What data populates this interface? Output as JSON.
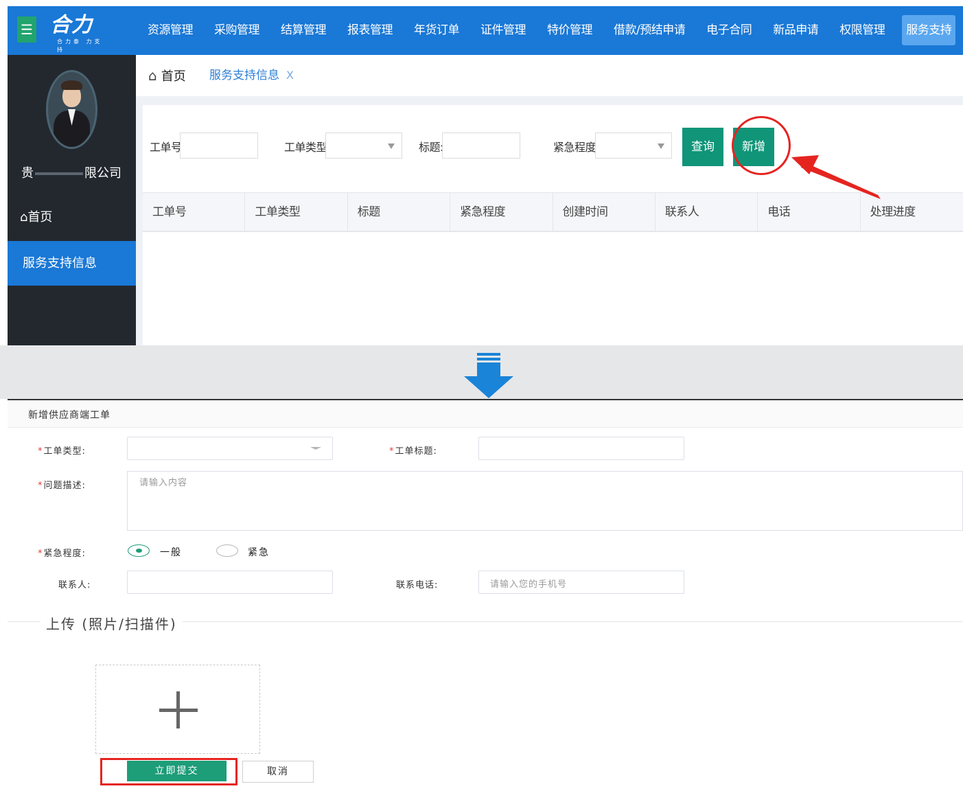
{
  "app": {
    "logo_text": "合力",
    "logo_subtext": "合力泰 力支持"
  },
  "topnav": [
    {
      "label": "资源管理"
    },
    {
      "label": "采购管理"
    },
    {
      "label": "结算管理"
    },
    {
      "label": "报表管理"
    },
    {
      "label": "年货订单"
    },
    {
      "label": "证件管理"
    },
    {
      "label": "特价管理"
    },
    {
      "label": "借款/预结申请"
    },
    {
      "label": "电子合同"
    },
    {
      "label": "新品申请"
    },
    {
      "label": "权限管理"
    },
    {
      "label": "服务支持",
      "active": true
    }
  ],
  "sidebar": {
    "company_start": "贵",
    "company_end": "限公司",
    "home_label": "首页",
    "active_item": "服务支持信息"
  },
  "tabs": {
    "home": "首页",
    "current": "服务支持信息",
    "close": "X"
  },
  "filters": {
    "order_no_label": "工单号:",
    "order_type_label": "工单类型:",
    "title_label": "标题:",
    "urgency_label": "紧急程度:",
    "query_button": "查询",
    "add_button": "新增"
  },
  "table": {
    "columns": [
      "工单号",
      "工单类型",
      "标题",
      "紧急程度",
      "创建时间",
      "联系人",
      "电话",
      "处理进度"
    ],
    "rows": []
  },
  "form": {
    "title": "新增供应商端工单",
    "required_mark": "*",
    "order_type_label": "工单类型:",
    "order_title_label": "工单标题:",
    "description_label": "问题描述:",
    "description_placeholder": "请输入内容",
    "urgency_label": "紧急程度:",
    "urgency_options": [
      {
        "label": "一般",
        "checked": true
      },
      {
        "label": "紧急",
        "checked": false
      }
    ],
    "contact_label": "联系人:",
    "phone_label": "联系电话:",
    "phone_placeholder": "请输入您的手机号",
    "upload_legend": "上传 (照片/扫描件)",
    "submit_button": "立即提交",
    "cancel_button": "取消"
  },
  "colors": {
    "topbar": "#1a78d6",
    "sidebar": "#23282f",
    "primary_green": "#109579",
    "annotation_red": "#e52420"
  }
}
